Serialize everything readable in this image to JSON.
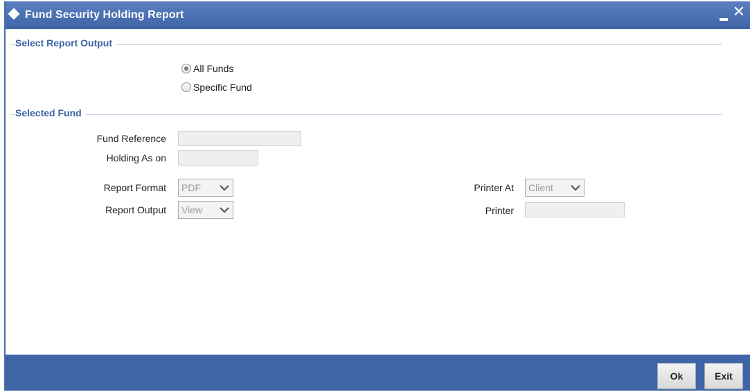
{
  "window": {
    "title": "Fund Security Holding Report"
  },
  "sections": {
    "report_output": "Select Report Output",
    "selected_fund": "Selected Fund"
  },
  "options": {
    "all_funds": "All Funds",
    "specific_fund": "Specific Fund",
    "selected": "All Funds"
  },
  "fields": {
    "fund_reference": {
      "label": "Fund Reference",
      "value": ""
    },
    "holding_as_on": {
      "label": "Holding As on",
      "value": ""
    },
    "report_format": {
      "label": "Report Format",
      "value": "PDF"
    },
    "report_output": {
      "label": "Report Output",
      "value": "View"
    },
    "printer_at": {
      "label": "Printer At",
      "value": "Client"
    },
    "printer": {
      "label": "Printer",
      "value": ""
    }
  },
  "footer": {
    "ok_label": "Ok",
    "exit_label": "Exit"
  },
  "icons": {
    "title": "diamond-icon",
    "minimize": "minimize-icon",
    "close": "close-icon",
    "dropdown": "chevron-down-icon"
  },
  "colors": {
    "accent": "#3f65a6",
    "section_text": "#3e63a4"
  }
}
